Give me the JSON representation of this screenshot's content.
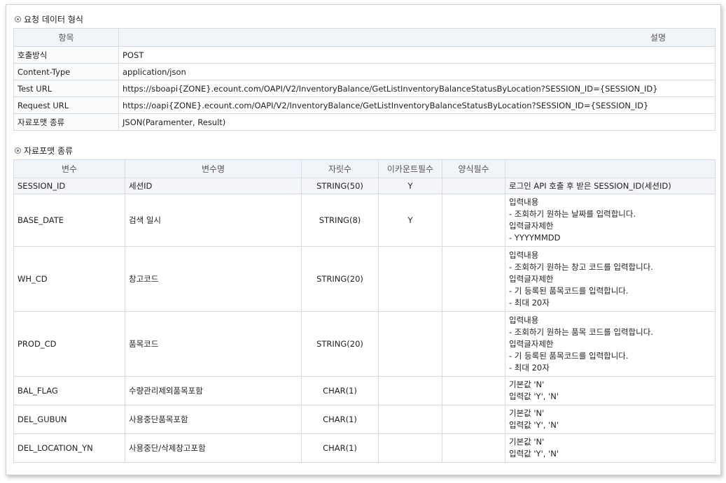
{
  "request_section": {
    "title": "요청 데이터 형식",
    "headers": [
      "항목",
      "설명"
    ],
    "rows": [
      {
        "key": "호출방식",
        "value": "POST"
      },
      {
        "key": "Content-Type",
        "value": "application/json"
      },
      {
        "key": "Test URL",
        "value": "https://sboapi{ZONE}.ecount.com/OAPI/V2/InventoryBalance/GetListInventoryBalanceStatusByLocation?SESSION_ID={SESSION_ID}"
      },
      {
        "key": "Request URL",
        "value": "https://oapi{ZONE}.ecount.com/OAPI/V2/InventoryBalance/GetListInventoryBalanceStatusByLocation?SESSION_ID={SESSION_ID}"
      },
      {
        "key": "자료포맷 종류",
        "value": "JSON(Paramenter, Result)"
      }
    ]
  },
  "format_section": {
    "title": "자료포맷 종류",
    "headers": [
      "변수",
      "변수명",
      "자릿수",
      "이카운트필수",
      "양식필수",
      ""
    ],
    "rows": [
      {
        "var": "SESSION_ID",
        "name": "세션ID",
        "size": "STRING(50)",
        "req": "Y",
        "form": "",
        "desc": [
          "로그인 API 호출 후 받은 SESSION_ID(세션ID)"
        ]
      },
      {
        "var": "BASE_DATE",
        "name": "검색 일시",
        "size": "STRING(8)",
        "req": "Y",
        "form": "",
        "desc": [
          "입력내용",
          "- 조회하기 원하는 날짜를 입력합니다.",
          "입력글자제한",
          "- YYYYMMDD"
        ]
      },
      {
        "var": "WH_CD",
        "name": "창고코드",
        "size": "STRING(20)",
        "req": "",
        "form": "",
        "desc": [
          "입력내용",
          "- 조회하기 원하는 창고 코드를 입력합니다.",
          "입력글자제한",
          "- 기 등록된 품목코드를 입력합니다.",
          "- 최대 20자"
        ]
      },
      {
        "var": "PROD_CD",
        "name": "품목코드",
        "size": "STRING(20)",
        "req": "",
        "form": "",
        "desc": [
          "입력내용",
          "- 조회하기 원하는 품목 코드를 입력합니다.",
          "입력글자제한",
          "- 기 등록된 품목코드를 입력합니다.",
          "- 최대 20자"
        ]
      },
      {
        "var": "BAL_FLAG",
        "name": "수량관리제외품목포함",
        "size": "CHAR(1)",
        "req": "",
        "form": "",
        "desc": [
          "기본값 'N'",
          "입력값 'Y', 'N'"
        ]
      },
      {
        "var": "DEL_GUBUN",
        "name": "사용중단품목포함",
        "size": "CHAR(1)",
        "req": "",
        "form": "",
        "desc": [
          "기본값 'N'",
          "입력값 'Y', 'N'"
        ]
      },
      {
        "var": "DEL_LOCATION_YN",
        "name": "사용중단/삭제창고포함",
        "size": "CHAR(1)",
        "req": "",
        "form": "",
        "desc": [
          "기본값 'N'",
          "입력값 'Y', 'N'"
        ]
      }
    ]
  }
}
